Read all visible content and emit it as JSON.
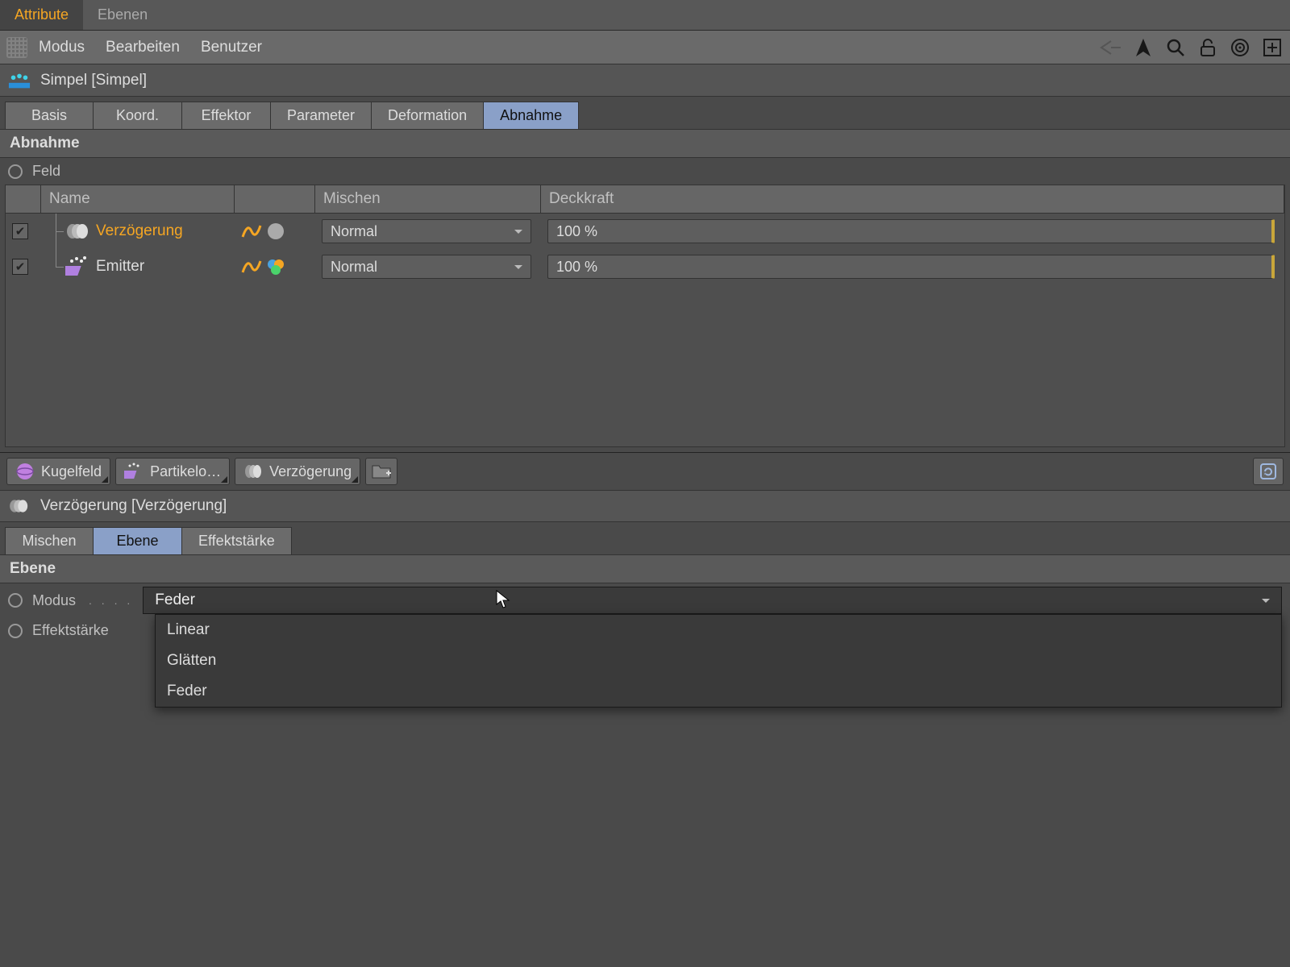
{
  "topTabs": {
    "attribute": "Attribute",
    "ebenen": "Ebenen"
  },
  "menu": {
    "modus": "Modus",
    "bearbeiten": "Bearbeiten",
    "benutzer": "Benutzer"
  },
  "upper": {
    "title": "Simpel [Simpel]",
    "tabs": {
      "basis": "Basis",
      "koord": "Koord.",
      "effektor": "Effektor",
      "parameter": "Parameter",
      "deformation": "Deformation",
      "abnahme": "Abnahme"
    },
    "section": "Abnahme",
    "feldLabel": "Feld",
    "tableHeaders": {
      "name": "Name",
      "mischen": "Mischen",
      "deckkraft": "Deckkraft"
    },
    "rows": [
      {
        "name": "Verzögerung",
        "mix": "Normal",
        "opacity": "100 %",
        "selected": true,
        "type": "delay"
      },
      {
        "name": "Emitter",
        "mix": "Normal",
        "opacity": "100 %",
        "selected": false,
        "type": "emitter"
      }
    ]
  },
  "quickNav": {
    "items": [
      {
        "label": "Kugelfeld",
        "icon": "sphere"
      },
      {
        "label": "Partikelo…",
        "icon": "particle"
      },
      {
        "label": "Verzögerung",
        "icon": "delay"
      }
    ]
  },
  "lower": {
    "title": "Verzögerung [Verzögerung]",
    "tabs": {
      "mischen": "Mischen",
      "ebene": "Ebene",
      "effektstaerke": "Effektstärke"
    },
    "section": "Ebene",
    "modusLabel": "Modus",
    "effektLabel": "Effektstärke",
    "modusValue": "Feder",
    "modusOptions": [
      "Linear",
      "Glätten",
      "Feder"
    ]
  }
}
